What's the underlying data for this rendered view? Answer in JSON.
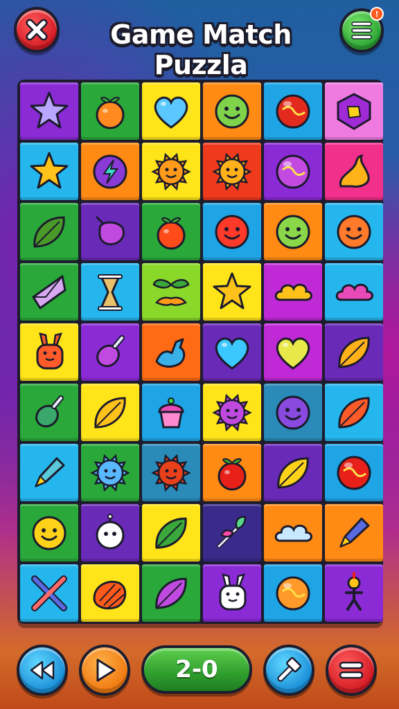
{
  "header": {
    "title": "Game Match Puzzla",
    "close_icon": "close-x-icon",
    "menu_icon": "hamburger-menu-icon",
    "notification_badge": "!"
  },
  "board": {
    "columns": 6,
    "rows": 9,
    "tiles": [
      {
        "bg": "#8a2bd6",
        "icon": "star-icon",
        "color": "#b9a7ff"
      },
      {
        "bg": "#2aa83a",
        "icon": "orange-sprout-icon",
        "color": "#ff8a1f"
      },
      {
        "bg": "#ffe41a",
        "icon": "heart-icon",
        "color": "#5ac8ff"
      },
      {
        "bg": "#ff8a14",
        "icon": "smiley-icon",
        "color": "#7ed34a"
      },
      {
        "bg": "#1fa5e6",
        "icon": "orb-icon",
        "color": "#e32a1e"
      },
      {
        "bg": "#f07be0",
        "icon": "gem-shield-icon",
        "color": "#a02ad6"
      },
      {
        "bg": "#26b6ee",
        "icon": "star-icon",
        "color": "#ffc21a"
      },
      {
        "bg": "#ff8a14",
        "icon": "lightning-orb-icon",
        "color": "#8a3ad6"
      },
      {
        "bg": "#ffe41a",
        "icon": "sun-icon",
        "color": "#ff9a1a"
      },
      {
        "bg": "#ef3a1e",
        "icon": "sun-icon",
        "color": "#ffb21a"
      },
      {
        "bg": "#8a2bd6",
        "icon": "globe-icon",
        "color": "#c24ae0"
      },
      {
        "bg": "#f0308a",
        "icon": "flame-icon",
        "color": "#ffb21a"
      },
      {
        "bg": "#2aa83a",
        "icon": "leaf-icon",
        "color": "#4a9a2a"
      },
      {
        "bg": "#6a2ab8",
        "icon": "berry-icon",
        "color": "#c04ae0"
      },
      {
        "bg": "#2aa83a",
        "icon": "tomato-icon",
        "color": "#ff4a1a"
      },
      {
        "bg": "#1fa5e6",
        "icon": "smiley-icon",
        "color": "#ff3a2a"
      },
      {
        "bg": "#ff8a14",
        "icon": "smiley-icon",
        "color": "#8ad84a"
      },
      {
        "bg": "#26b6ee",
        "icon": "smiley-icon",
        "color": "#ff7a2a"
      },
      {
        "bg": "#2aa83a",
        "icon": "crystal-icon",
        "color": "#d8a8f0"
      },
      {
        "bg": "#26b6ee",
        "icon": "hourglass-icon",
        "color": "#e8c16a"
      },
      {
        "bg": "#8ad82a",
        "icon": "leaf-pair-icon",
        "color": "#3aa83a"
      },
      {
        "bg": "#ffe41a",
        "icon": "star-icon",
        "color": "#ffc21a"
      },
      {
        "bg": "#c02ad6",
        "icon": "cloud-icon",
        "color": "#ffc21a"
      },
      {
        "bg": "#26b6ee",
        "icon": "cloud-icon",
        "color": "#e84ab8"
      },
      {
        "bg": "#ffe41a",
        "icon": "bunny-icon",
        "color": "#ff5a2a"
      },
      {
        "bg": "#8a2bd6",
        "icon": "potion-icon",
        "color": "#c04ae0"
      },
      {
        "bg": "#ff6a14",
        "icon": "bird-icon",
        "color": "#3ab0e8"
      },
      {
        "bg": "#6a2ab8",
        "icon": "heart-icon",
        "color": "#3ac8ff"
      },
      {
        "bg": "#c02ad6",
        "icon": "heart-icon",
        "color": "#e8e84a"
      },
      {
        "bg": "#6a2ab8",
        "icon": "seed-icon",
        "color": "#ffb21a"
      },
      {
        "bg": "#2aa83a",
        "icon": "bottle-icon",
        "color": "#3aa86a"
      },
      {
        "bg": "#ffe41a",
        "icon": "feather-icon",
        "color": "#ffc21a"
      },
      {
        "bg": "#1fa5e6",
        "icon": "cupcake-icon",
        "color": "#e84ab8"
      },
      {
        "bg": "#ffe41a",
        "icon": "sun-icon",
        "color": "#c04ae0"
      },
      {
        "bg": "#2a8ab8",
        "icon": "smiley-icon",
        "color": "#8a4ae0"
      },
      {
        "bg": "#26b6ee",
        "icon": "leaf-icon",
        "color": "#ff5a2a"
      },
      {
        "bg": "#26b6ee",
        "icon": "rocket-icon",
        "color": "#5ac8d8"
      },
      {
        "bg": "#2aa83a",
        "icon": "sun-icon",
        "color": "#5ab8ff"
      },
      {
        "bg": "#2a8ab8",
        "icon": "sun-icon",
        "color": "#e8401a"
      },
      {
        "bg": "#ff8a14",
        "icon": "apple-icon",
        "color": "#e8201a"
      },
      {
        "bg": "#6a2ab8",
        "icon": "feather-icon",
        "color": "#ffd21a"
      },
      {
        "bg": "#1fa5e6",
        "icon": "orb-icon",
        "color": "#e8201a"
      },
      {
        "bg": "#2aa83a",
        "icon": "smiley-icon",
        "color": "#ffd21a"
      },
      {
        "bg": "#6a2ab8",
        "icon": "ghost-icon",
        "color": "#ffffff"
      },
      {
        "bg": "#ffe41a",
        "icon": "leaf-icon",
        "color": "#3aa83a"
      },
      {
        "bg": "#3a2a8a",
        "icon": "sprout-icon",
        "color": "#5ad88a"
      },
      {
        "bg": "#ff8a14",
        "icon": "cloud-icon",
        "color": "#c8e8ff"
      },
      {
        "bg": "#ff8a14",
        "icon": "pencil-icon",
        "color": "#5a6ae0"
      },
      {
        "bg": "#26b6ee",
        "icon": "crossed-swords-icon",
        "color": "#5a6ae0"
      },
      {
        "bg": "#ffe41a",
        "icon": "shell-icon",
        "color": "#ff5a1a"
      },
      {
        "bg": "#2aa83a",
        "icon": "leaf-icon",
        "color": "#c04ae0"
      },
      {
        "bg": "#8a2bd6",
        "icon": "bunny-icon",
        "color": "#ffffff"
      },
      {
        "bg": "#1fa5e6",
        "icon": "orb-icon",
        "color": "#ff9a2a"
      },
      {
        "bg": "#8a2bd6",
        "icon": "stick-figure-icon",
        "color": "#ffc21a"
      }
    ]
  },
  "footer": {
    "rewind_icon": "rewind-icon",
    "play_icon": "play-icon",
    "score": "2-0",
    "hint_icon": "hammer-icon",
    "pause_icon": "equals-icon"
  }
}
